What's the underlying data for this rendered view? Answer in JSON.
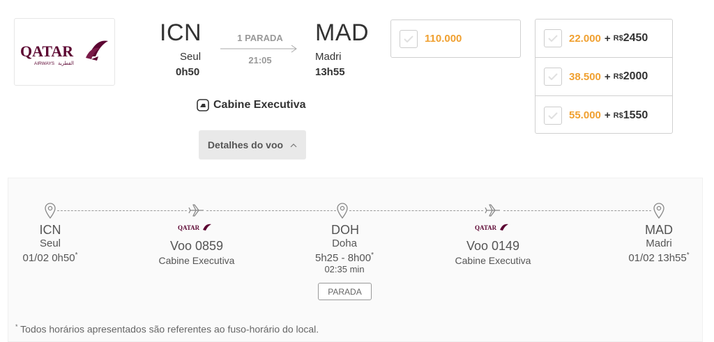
{
  "airline": {
    "name": "QATAR",
    "sub": "AIRWAYS",
    "arabic": "القطرية",
    "brand_color": "#5c0632"
  },
  "route": {
    "origin_code": "ICN",
    "origin_city": "Seul",
    "origin_time": "0h50",
    "dest_code": "MAD",
    "dest_city": "Madri",
    "dest_time": "13h55",
    "stops_label": "1 PARADA",
    "duration": "21:05"
  },
  "cabin_label": "Cabine Executiva",
  "details_button": "Detalhes do voo",
  "price_main": {
    "miles": "110.000"
  },
  "price_options": [
    {
      "miles": "22.000",
      "plus": "+",
      "currency": "R$",
      "amount": "2450"
    },
    {
      "miles": "38.500",
      "plus": "+",
      "currency": "R$",
      "amount": "2000"
    },
    {
      "miles": "55.000",
      "plus": "+",
      "currency": "R$",
      "amount": "1550"
    }
  ],
  "timeline": {
    "origin": {
      "code": "ICN",
      "city": "Seul",
      "date": "01/02 0h50",
      "mark": "*"
    },
    "flight1": {
      "airline": "QATAR",
      "number": "Voo 0859",
      "cabin": "Cabine Executiva"
    },
    "stop": {
      "code": "DOH",
      "city": "Doha",
      "times": "5h25 - 8h00",
      "mark": "*",
      "layover": "02:35 min",
      "badge": "PARADA"
    },
    "flight2": {
      "airline": "QATAR",
      "number": "Voo 0149",
      "cabin": "Cabine Executiva"
    },
    "dest": {
      "code": "MAD",
      "city": "Madri",
      "date": "01/02 13h55",
      "mark": "*"
    }
  },
  "footnote": {
    "mark": "*",
    "text": " Todos horários apresentados são referentes ao fuso-horário do local."
  },
  "colors": {
    "accent_orange": "#f0a030",
    "qatar_maroon": "#5c0632"
  }
}
